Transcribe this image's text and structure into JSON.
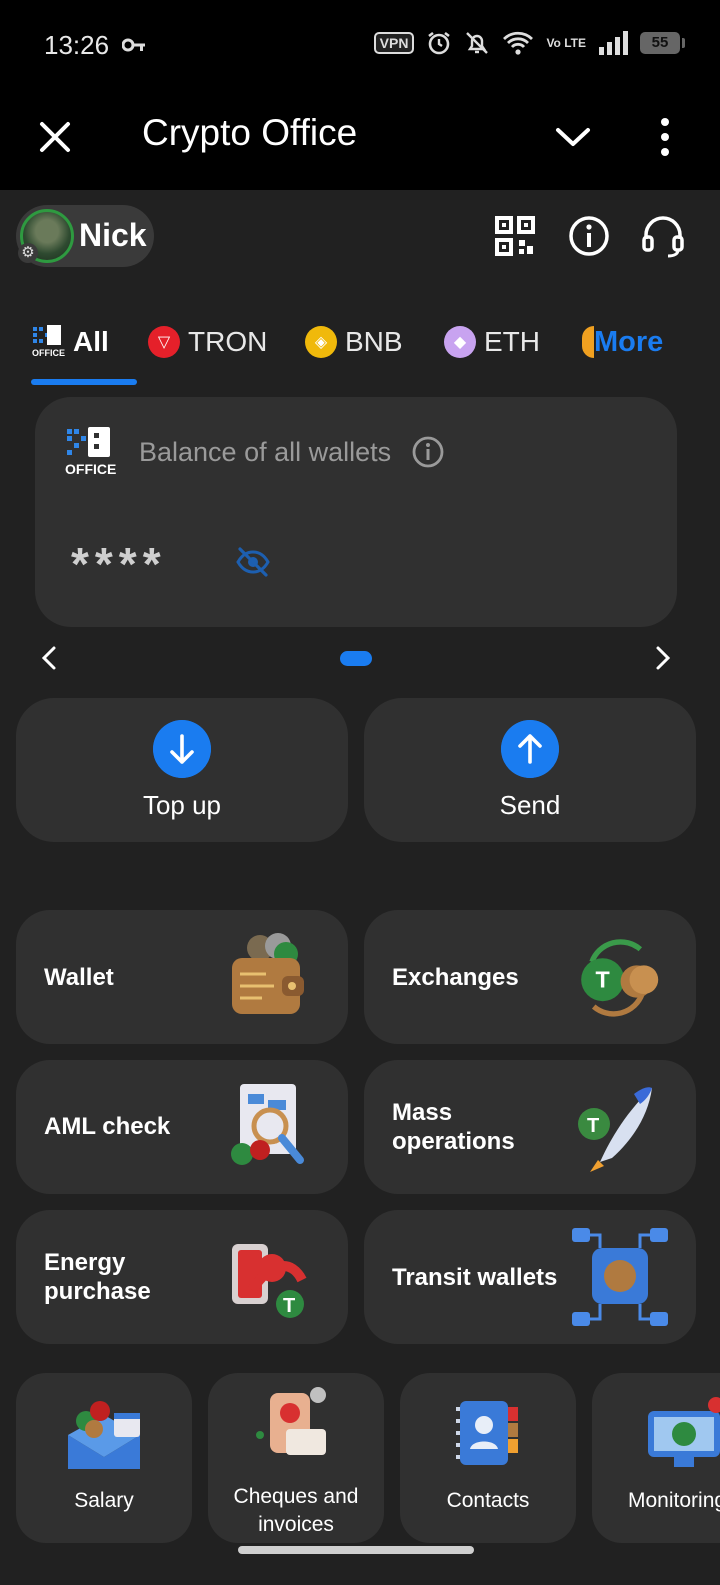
{
  "status_bar": {
    "time": "13:26",
    "vpn": "VPN",
    "volte": "Vo LTE",
    "battery": "55"
  },
  "app_bar": {
    "title": "Crypto Office"
  },
  "profile": {
    "name": "Nick"
  },
  "tabs": [
    {
      "label": "All",
      "active": true
    },
    {
      "label": "TRON",
      "color": "#e5202a"
    },
    {
      "label": "BNB",
      "color": "#f0b90b"
    },
    {
      "label": "ETH",
      "color": "#c8a3f0"
    },
    {
      "label": "More",
      "color": "#1a7cf0"
    }
  ],
  "balance": {
    "label": "Balance of all wallets",
    "value": "****",
    "logo_text": "OFFICE"
  },
  "actions": {
    "top_up": "Top up",
    "send": "Send"
  },
  "tiles": {
    "wallet": "Wallet",
    "exchanges": "Exchanges",
    "aml_check": "AML check",
    "mass_operations_line1": "Mass",
    "mass_operations_line2": "operations",
    "energy_purchase_line1": "Energy",
    "energy_purchase_line2": "purchase",
    "transit_wallets": "Transit wallets"
  },
  "services": {
    "salary": "Salary",
    "cheques_line1": "Cheques and",
    "cheques_line2": "invoices",
    "contacts": "Contacts",
    "monitoring": "Monitoring"
  },
  "colors": {
    "accent": "#1a7cf0",
    "background": "#212121",
    "card": "#303030"
  }
}
